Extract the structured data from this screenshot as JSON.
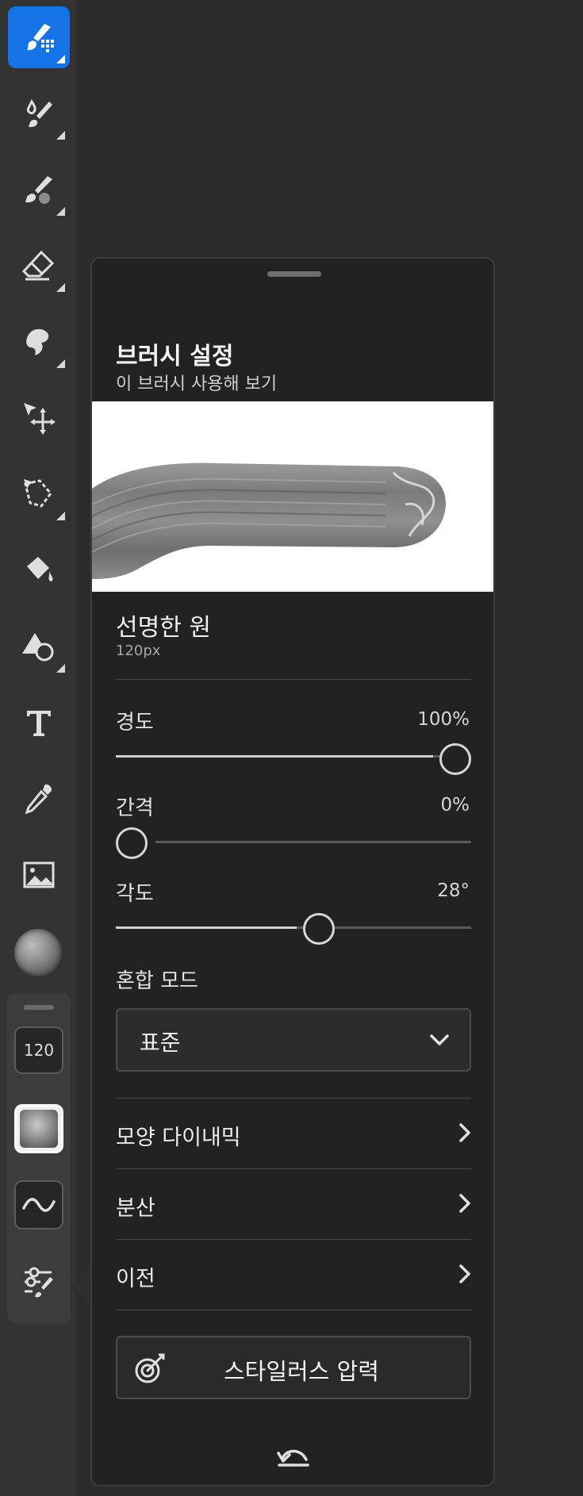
{
  "toolbar": {
    "tools": [
      {
        "name": "paint-brush-tool",
        "active": true
      },
      {
        "name": "mixer-brush-tool",
        "active": false
      },
      {
        "name": "smudge-brush-tool",
        "active": false
      },
      {
        "name": "eraser-tool",
        "active": false
      },
      {
        "name": "lasso-tool",
        "active": false
      },
      {
        "name": "move-tool",
        "active": false
      },
      {
        "name": "selection-tool",
        "active": false
      },
      {
        "name": "fill-tool",
        "active": false
      },
      {
        "name": "shape-tool",
        "active": false
      },
      {
        "name": "type-tool",
        "active": false
      },
      {
        "name": "eyedropper-tool",
        "active": false
      },
      {
        "name": "image-tool",
        "active": false
      }
    ],
    "accent_color": "#1473e6"
  },
  "sub_toolbar": {
    "brush_size": "120"
  },
  "panel": {
    "title": "브러시 설정",
    "subtitle": "이 브러시 사용해 보기",
    "brush_name": "선명한 원",
    "brush_size": "120px",
    "sliders": {
      "hardness": {
        "label": "경도",
        "value_text": "100%",
        "value": 100
      },
      "spacing": {
        "label": "간격",
        "value_text": "0%",
        "value": 0
      },
      "angle": {
        "label": "각도",
        "value_text": "28°",
        "value": 56
      }
    },
    "blend_mode": {
      "label": "혼합 모드",
      "value": "표준"
    },
    "rows": {
      "shape_dynamics": "모양 다이내믹",
      "scatter": "분산",
      "transfer": "이전"
    },
    "stylus_button": "스타일러스 압력"
  }
}
